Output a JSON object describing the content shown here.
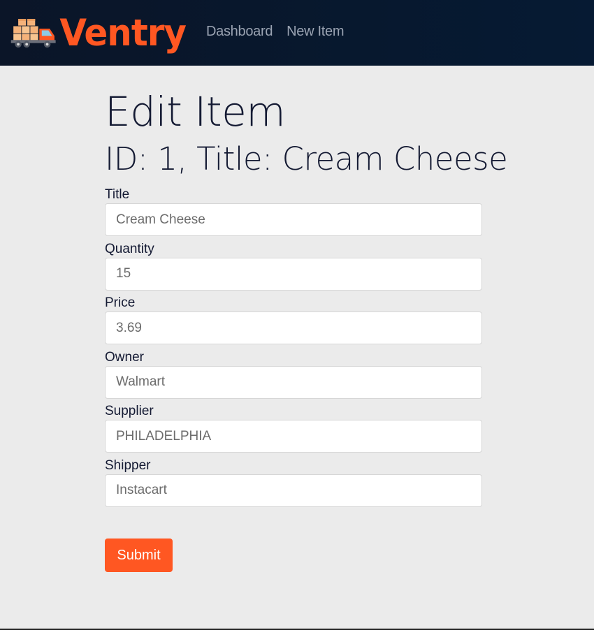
{
  "brand": {
    "name": "Ventry",
    "logo_icon": "delivery-truck-icon",
    "color": "#ff5722"
  },
  "nav": {
    "links": [
      "Dashboard",
      "New Item"
    ]
  },
  "page": {
    "title": "Edit Item",
    "subtitle": "ID: 1, Title: Cream Cheese"
  },
  "form": {
    "fields": [
      {
        "label": "Title",
        "value": "Cream Cheese"
      },
      {
        "label": "Quantity",
        "value": "15"
      },
      {
        "label": "Price",
        "value": "3.69"
      },
      {
        "label": "Owner",
        "value": "Walmart"
      },
      {
        "label": "Supplier",
        "value": "PHILADELPHIA"
      },
      {
        "label": "Shipper",
        "value": "Instacart"
      }
    ],
    "submit_label": "Submit"
  },
  "colors": {
    "navbar_bg": "#0b1528",
    "accent": "#ff5722",
    "page_bg": "#ebebeb"
  }
}
